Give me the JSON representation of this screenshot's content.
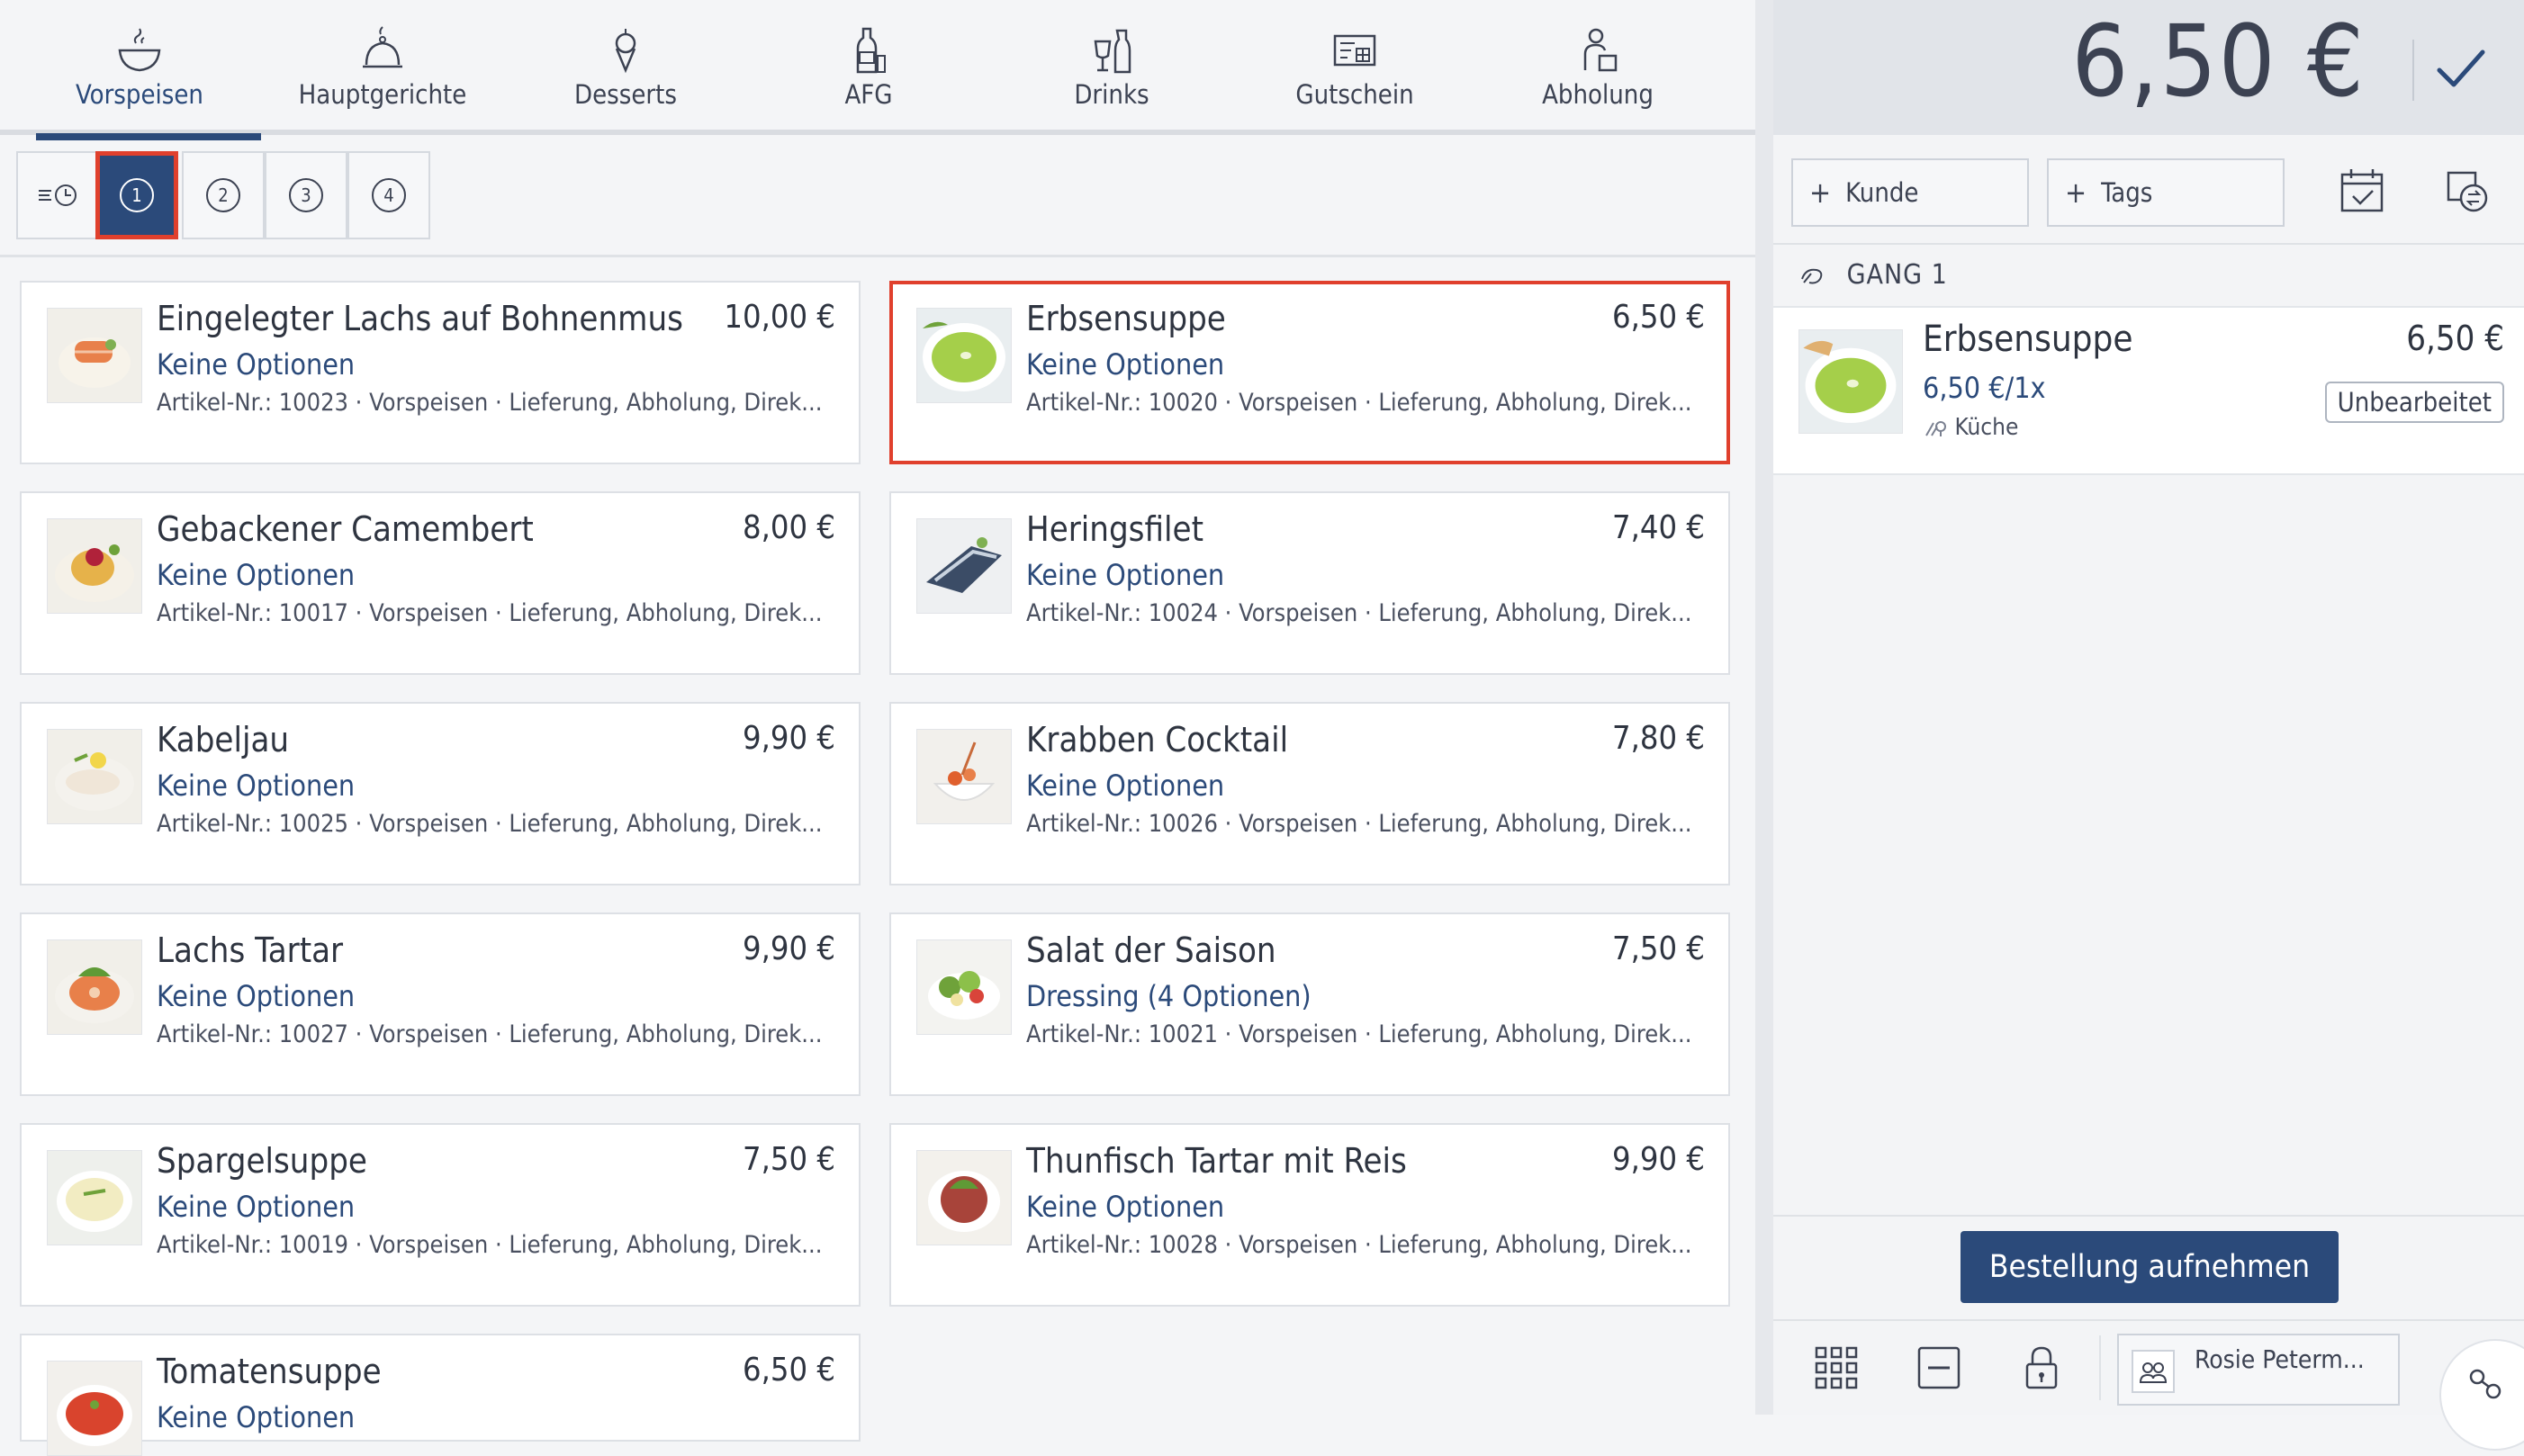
{
  "categories": [
    {
      "label": "Vorspeisen",
      "icon": "soup-bowl-icon",
      "active": true
    },
    {
      "label": "Hauptgerichte",
      "icon": "cloche-icon",
      "active": false
    },
    {
      "label": "Desserts",
      "icon": "ice-cream-icon",
      "active": false
    },
    {
      "label": "AFG",
      "icon": "bottle-icon",
      "active": false
    },
    {
      "label": "Drinks",
      "icon": "glasses-icon",
      "active": false
    },
    {
      "label": "Gutschein",
      "icon": "voucher-icon",
      "active": false
    },
    {
      "label": "Abholung",
      "icon": "pickup-icon",
      "active": false
    }
  ],
  "courses": [
    "1",
    "2",
    "3",
    "4"
  ],
  "active_course": "1",
  "products": [
    {
      "name": "Eingelegter Lachs auf Bohnenmus",
      "price": "10,00 €",
      "options": "Keine Optionen",
      "meta": "Artikel-Nr.: 10023 · Vorspeisen · Lieferung, Abholung, Direk..."
    },
    {
      "name": "Erbsensuppe",
      "price": "6,50 €",
      "options": "Keine Optionen",
      "meta": "Artikel-Nr.: 10020 · Vorspeisen · Lieferung, Abholung, Direk..."
    },
    {
      "name": "Gebackener Camembert",
      "price": "8,00 €",
      "options": "Keine Optionen",
      "meta": "Artikel-Nr.: 10017 · Vorspeisen · Lieferung, Abholung, Direk..."
    },
    {
      "name": "Heringsfilet",
      "price": "7,40 €",
      "options": "Keine Optionen",
      "meta": "Artikel-Nr.: 10024 · Vorspeisen · Lieferung, Abholung, Direk..."
    },
    {
      "name": "Kabeljau",
      "price": "9,90 €",
      "options": "Keine Optionen",
      "meta": "Artikel-Nr.: 10025 · Vorspeisen · Lieferung, Abholung, Direk..."
    },
    {
      "name": "Krabben Cocktail",
      "price": "7,80 €",
      "options": "Keine Optionen",
      "meta": "Artikel-Nr.: 10026 · Vorspeisen · Lieferung, Abholung, Direk..."
    },
    {
      "name": "Lachs Tartar",
      "price": "9,90 €",
      "options": "Keine Optionen",
      "meta": "Artikel-Nr.: 10027 · Vorspeisen · Lieferung, Abholung, Direk..."
    },
    {
      "name": "Salat der Saison",
      "price": "7,50 €",
      "options": "Dressing (4 Optionen)",
      "meta": "Artikel-Nr.: 10021 · Vorspeisen · Lieferung, Abholung, Direk..."
    },
    {
      "name": "Spargelsuppe",
      "price": "7,50 €",
      "options": "Keine Optionen",
      "meta": "Artikel-Nr.: 10019 · Vorspeisen · Lieferung, Abholung, Direk..."
    },
    {
      "name": "Thunfisch Tartar mit Reis",
      "price": "9,90 €",
      "options": "Keine Optionen",
      "meta": "Artikel-Nr.: 10028 · Vorspeisen · Lieferung, Abholung, Direk..."
    },
    {
      "name": "Tomatensuppe",
      "price": "6,50 €",
      "options": "Keine Optionen",
      "meta": ""
    }
  ],
  "order": {
    "total": "6,50 €",
    "customer_label": "Kunde",
    "tags_label": "Tags",
    "course_heading": "GANG 1",
    "items": [
      {
        "name": "Erbsensuppe",
        "price": "6,50 €",
        "unit": "6,50 €/1x",
        "station": "Küche",
        "status": "Unbearbeitet"
      }
    ],
    "submit_label": "Bestellung aufnehmen",
    "user_name": "Rosie Peterm..."
  },
  "colors": {
    "accent": "#2b4a7a",
    "highlight": "#e0402d"
  }
}
